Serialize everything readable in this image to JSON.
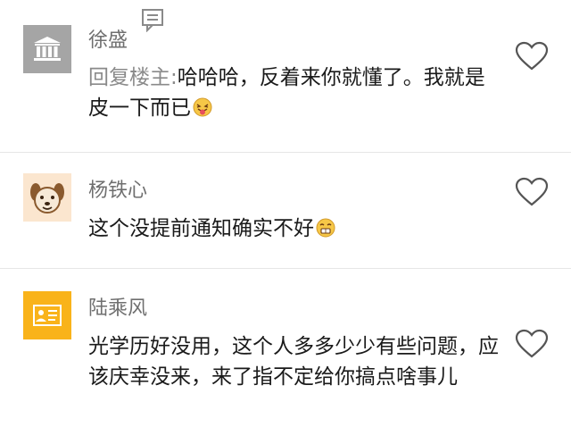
{
  "comments": [
    {
      "author": "徐盛",
      "reply_prefix": "回复楼主:",
      "text": "哈哈哈，反着来你就懂了。我就是皮一下而已",
      "avatar_icon": "bank-building-icon",
      "emoji_icon": "tongue-out-emoji-icon"
    },
    {
      "author": "杨铁心",
      "text": "这个没提前通知确实不好",
      "avatar_icon": "dog-face-icon",
      "emoji_icon": "grimace-emoji-icon"
    },
    {
      "author": "陆乘风",
      "text": "光学历好没用，这个人多多少少有些问题，应该庆幸没来，来了指不定给你搞点啥事儿",
      "avatar_icon": "id-card-icon"
    }
  ],
  "colors": {
    "author": "#6f6f6f",
    "text": "#1a1a1a",
    "prefix": "#8a8a8a",
    "divider": "#e6e6e6",
    "avatar1_bg": "#a5a5a5",
    "avatar2_bg": "#fbe6cf",
    "avatar3_bg": "#f9b31a"
  }
}
